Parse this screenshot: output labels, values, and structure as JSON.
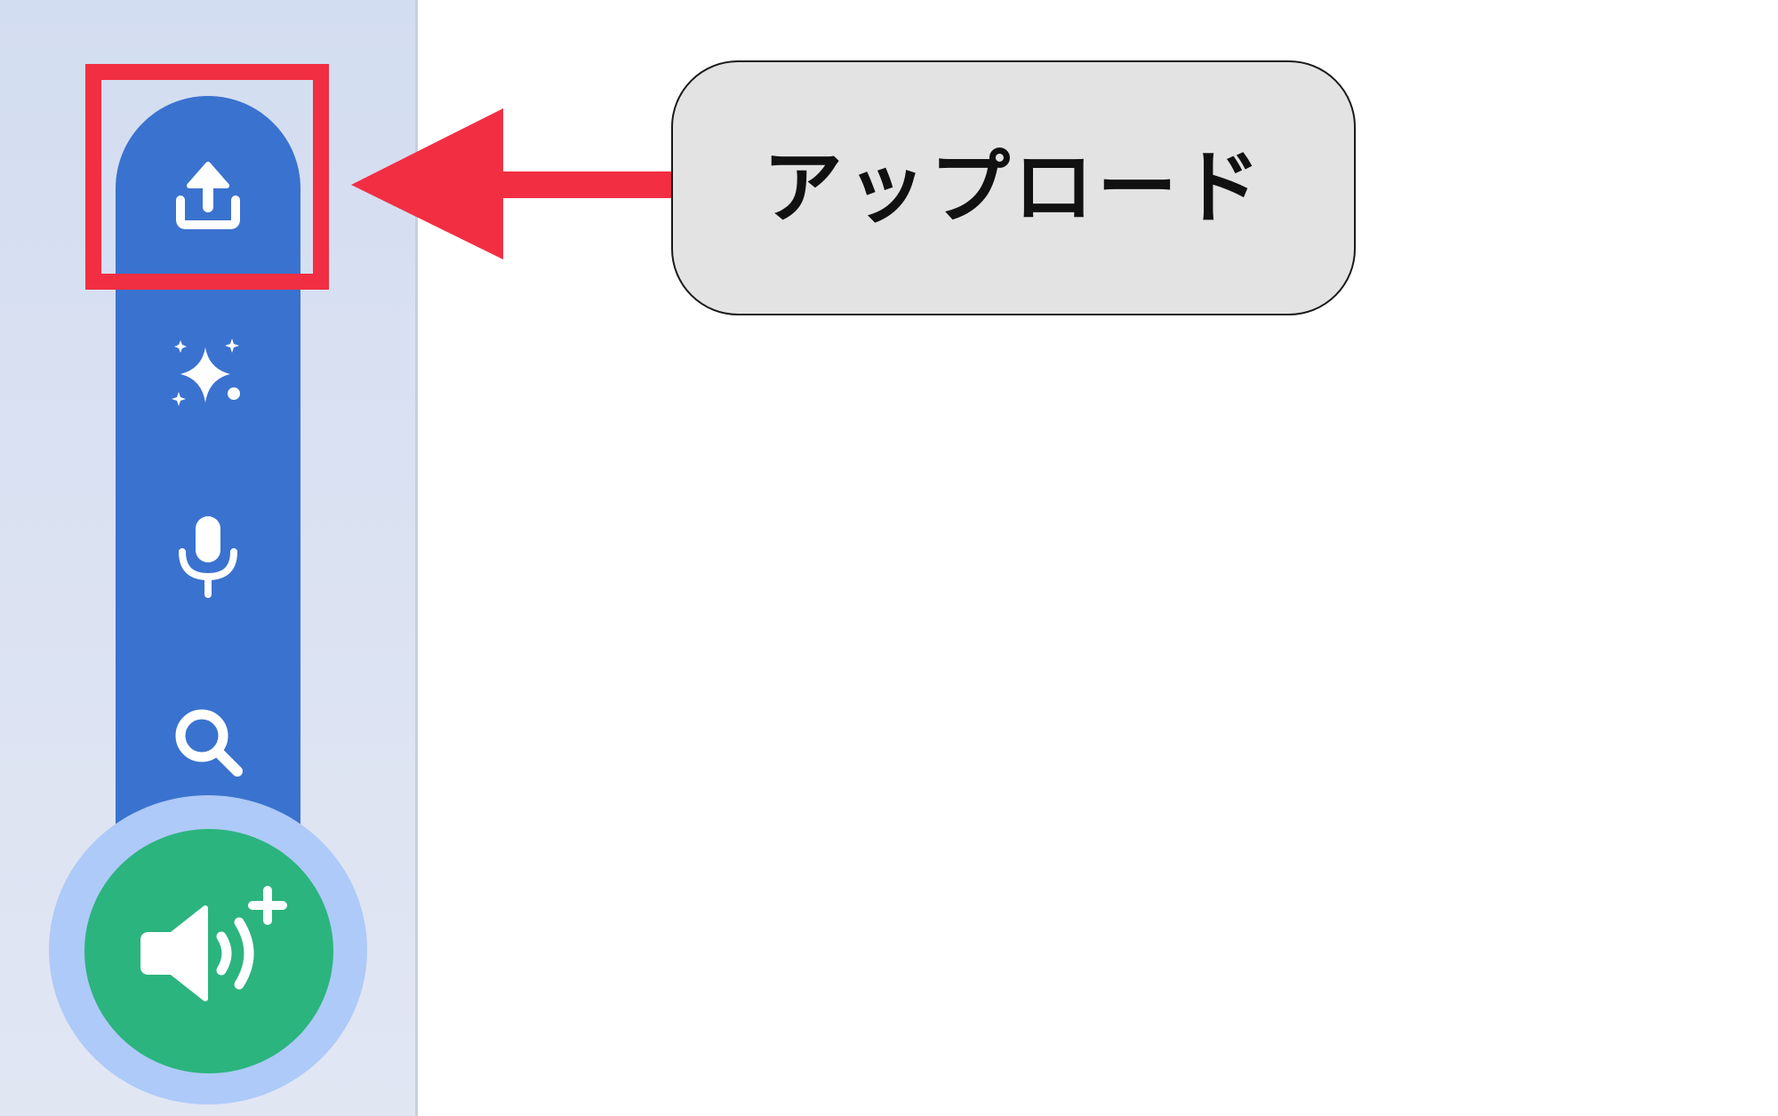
{
  "annotation": {
    "callout_label": "アップロード",
    "highlight_color": "#f22e42",
    "callout_bg": "#e3e3e3"
  },
  "toolbar": {
    "color": "#3a72cf",
    "items": [
      {
        "icon": "upload-icon",
        "highlighted": true
      },
      {
        "icon": "sparkles-icon",
        "highlighted": false
      },
      {
        "icon": "microphone-icon",
        "highlighted": false
      },
      {
        "icon": "search-icon",
        "highlighted": false
      }
    ]
  },
  "fab": {
    "icon": "speaker-plus-icon",
    "color": "#2bb47e",
    "halo_color": "#aecaf8"
  },
  "sidebar": {
    "background": "#dbe2f2"
  }
}
